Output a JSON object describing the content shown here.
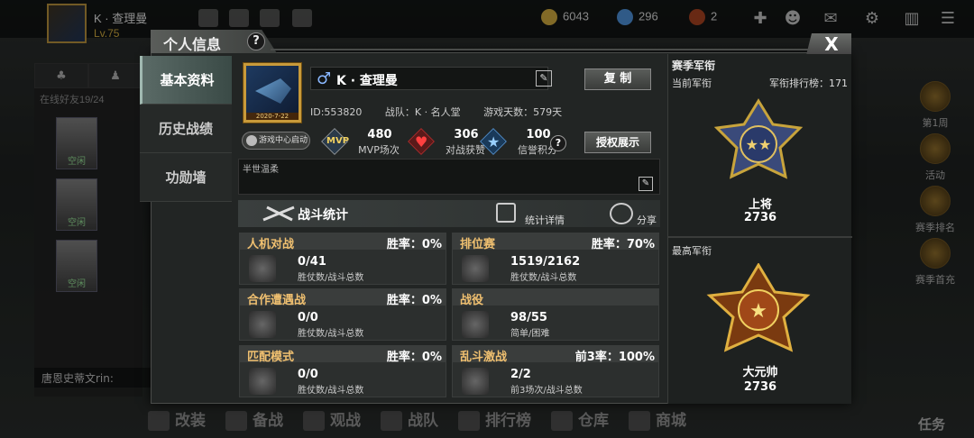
{
  "topbar": {
    "player_name": "K · 查理曼",
    "level": "Lv.75",
    "gold": "6043",
    "diamonds": "296",
    "tokens": "2"
  },
  "left_col": {
    "status": "在线好友19/24",
    "friend_status": "空闲",
    "chat_preview": "唐恩史蒂文rin:"
  },
  "right_col": {
    "items": [
      "第1周",
      "活动",
      "赛季排名",
      "赛季首充"
    ]
  },
  "bottom_nav": {
    "items": [
      "改装",
      "备战",
      "观战",
      "战队",
      "排行榜",
      "仓库",
      "商城"
    ],
    "task_label": "任务"
  },
  "panel": {
    "title": "个人信息",
    "help": "?",
    "close": "X"
  },
  "side_tabs": [
    "基本资料",
    "历史战绩",
    "功勋墙"
  ],
  "profile": {
    "avatar_date": "2020-7-22",
    "name": "K · 查理曼",
    "copy_label": "复 制",
    "id_text": "ID:553820",
    "team_text": "战队：K · 名人堂",
    "days_text": "游戏天数：579天",
    "launch_label": "游戏中心启动",
    "mvp_badge": "MVP",
    "mvp_value": "480",
    "mvp_label": "MVP场次",
    "likes_value": "306",
    "likes_label": "对战获赞",
    "credit_value": "100",
    "credit_label": "信誉积分",
    "credit_help": "?",
    "auth_label": "授权展示",
    "signature": "半世温柔"
  },
  "stats": {
    "title": "战斗统计",
    "detail_label": "统计详情",
    "share_label": "分享",
    "cards": [
      {
        "mode": "人机对战",
        "rate": "胜率：0%",
        "value": "0/41",
        "sub": "胜仗数/战斗总数"
      },
      {
        "mode": "排位赛",
        "rate": "胜率：70%",
        "value": "1519/2162",
        "sub": "胜仗数/战斗总数"
      },
      {
        "mode": "合作遭遇战",
        "rate": "胜率：0%",
        "value": "0/0",
        "sub": "胜仗数/战斗总数"
      },
      {
        "mode": "战役",
        "rate": "",
        "value": "98/55",
        "sub": "简单/困难"
      },
      {
        "mode": "匹配模式",
        "rate": "胜率：0%",
        "value": "0/0",
        "sub": "胜仗数/战斗总数"
      },
      {
        "mode": "乱斗激战",
        "rate": "前3率：100%",
        "value": "2/2",
        "sub": "前3场次/战斗总数"
      }
    ]
  },
  "rank": {
    "season_title": "赛季军衔",
    "current_label": "当前军衔",
    "rank_place": "军衔排行榜：171",
    "current_rank": "上将",
    "current_score": "2736",
    "highest_label": "最高军衔",
    "highest_rank": "大元帅",
    "highest_score": "2736"
  },
  "colors": {
    "gold_accent": "#c89a3a",
    "mode_label": "#f0c070",
    "active_tab": "#5a6a66"
  }
}
